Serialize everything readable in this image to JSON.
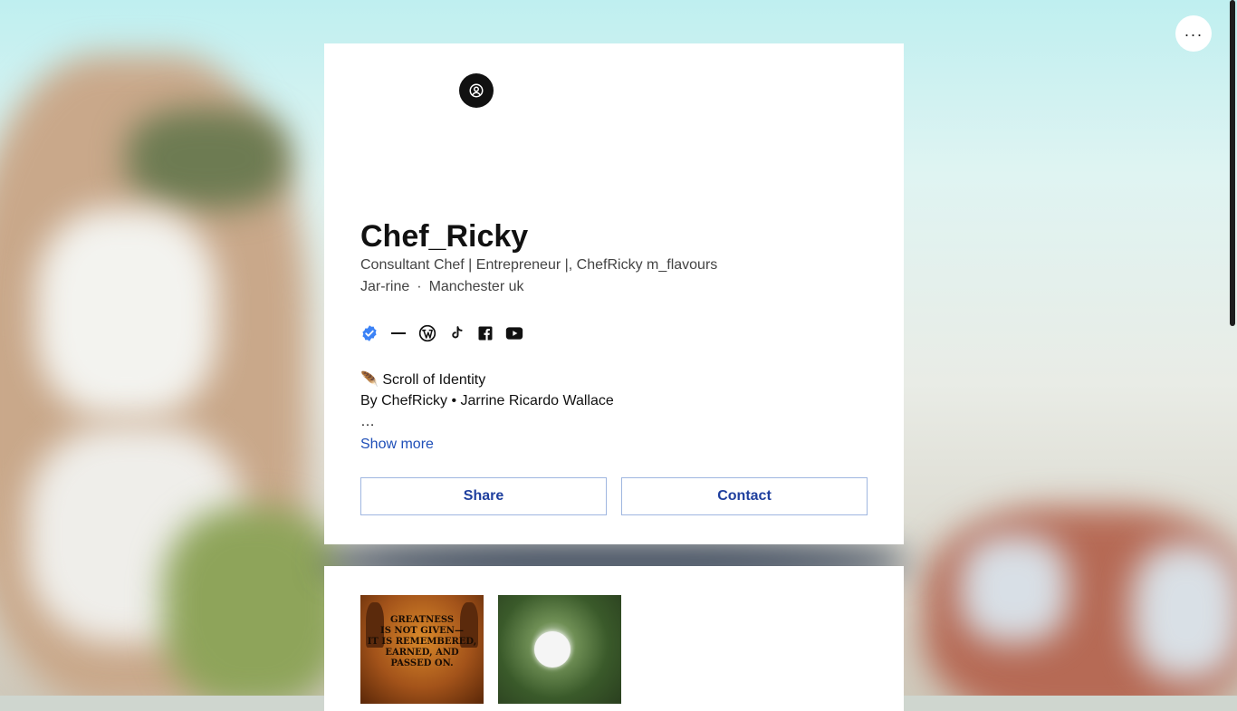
{
  "profile": {
    "name": "Chef_Ricky",
    "tagline": "Consultant Chef | Entrepreneur |, ChefRicky m_flavours",
    "handle": "Jar-rine",
    "separator": "·",
    "location": "Manchester uk"
  },
  "social_icons": [
    "verified-badge-icon",
    "dash-icon",
    "wordpress-icon",
    "tiktok-icon",
    "facebook-icon",
    "youtube-icon"
  ],
  "bio": {
    "line1": "🪶 Scroll of Identity",
    "line2": "By ChefRicky • Jarrine Ricardo Wallace",
    "line3": "…",
    "show_more": "Show more"
  },
  "actions": {
    "share_label": "Share",
    "contact_label": "Contact"
  },
  "menu": {
    "more_label": "···"
  },
  "gallery": {
    "items": [
      {
        "caption": "GREATNESS\nIS NOT GIVEN—\nIT IS REMEMBERED,\nEARNED, AND\nPASSED ON."
      },
      {
        "caption": ""
      }
    ]
  },
  "colors": {
    "link": "#1f4fb8",
    "button_text": "#1f3f9e",
    "verified": "#3b82f6"
  }
}
